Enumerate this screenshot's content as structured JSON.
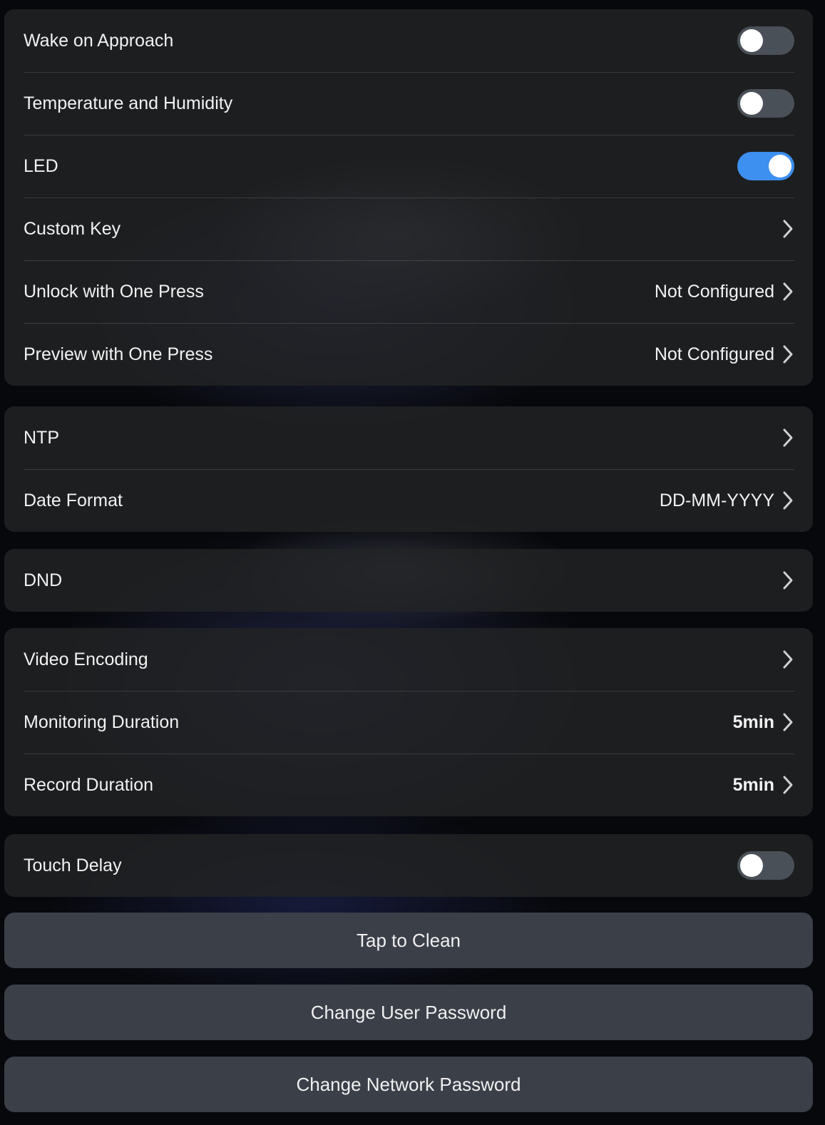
{
  "group1": {
    "wake_on_approach": {
      "label": "Wake on Approach",
      "enabled": false
    },
    "temp_humidity": {
      "label": "Temperature and Humidity",
      "enabled": false
    },
    "led": {
      "label": "LED",
      "enabled": true
    },
    "custom_key": {
      "label": "Custom Key"
    },
    "unlock_one_press": {
      "label": "Unlock with One Press",
      "value": "Not Configured"
    },
    "preview_one_press": {
      "label": "Preview with One Press",
      "value": "Not Configured"
    }
  },
  "group2": {
    "ntp": {
      "label": "NTP"
    },
    "date_format": {
      "label": "Date Format",
      "value": "DD-MM-YYYY"
    }
  },
  "group3": {
    "dnd": {
      "label": "DND"
    }
  },
  "group4": {
    "video_encoding": {
      "label": "Video Encoding"
    },
    "monitoring_duration": {
      "label": "Monitoring Duration",
      "value": "5min"
    },
    "record_duration": {
      "label": "Record Duration",
      "value": "5min"
    }
  },
  "group5": {
    "touch_delay": {
      "label": "Touch Delay",
      "enabled": false
    }
  },
  "buttons": {
    "tap_to_clean": "Tap to Clean",
    "change_user_password": "Change User Password",
    "change_network_password": "Change Network Password"
  },
  "colors": {
    "toggle_on": "#3d8ff0",
    "toggle_off": "#4a5058",
    "button_bg": "#3a3f48"
  }
}
